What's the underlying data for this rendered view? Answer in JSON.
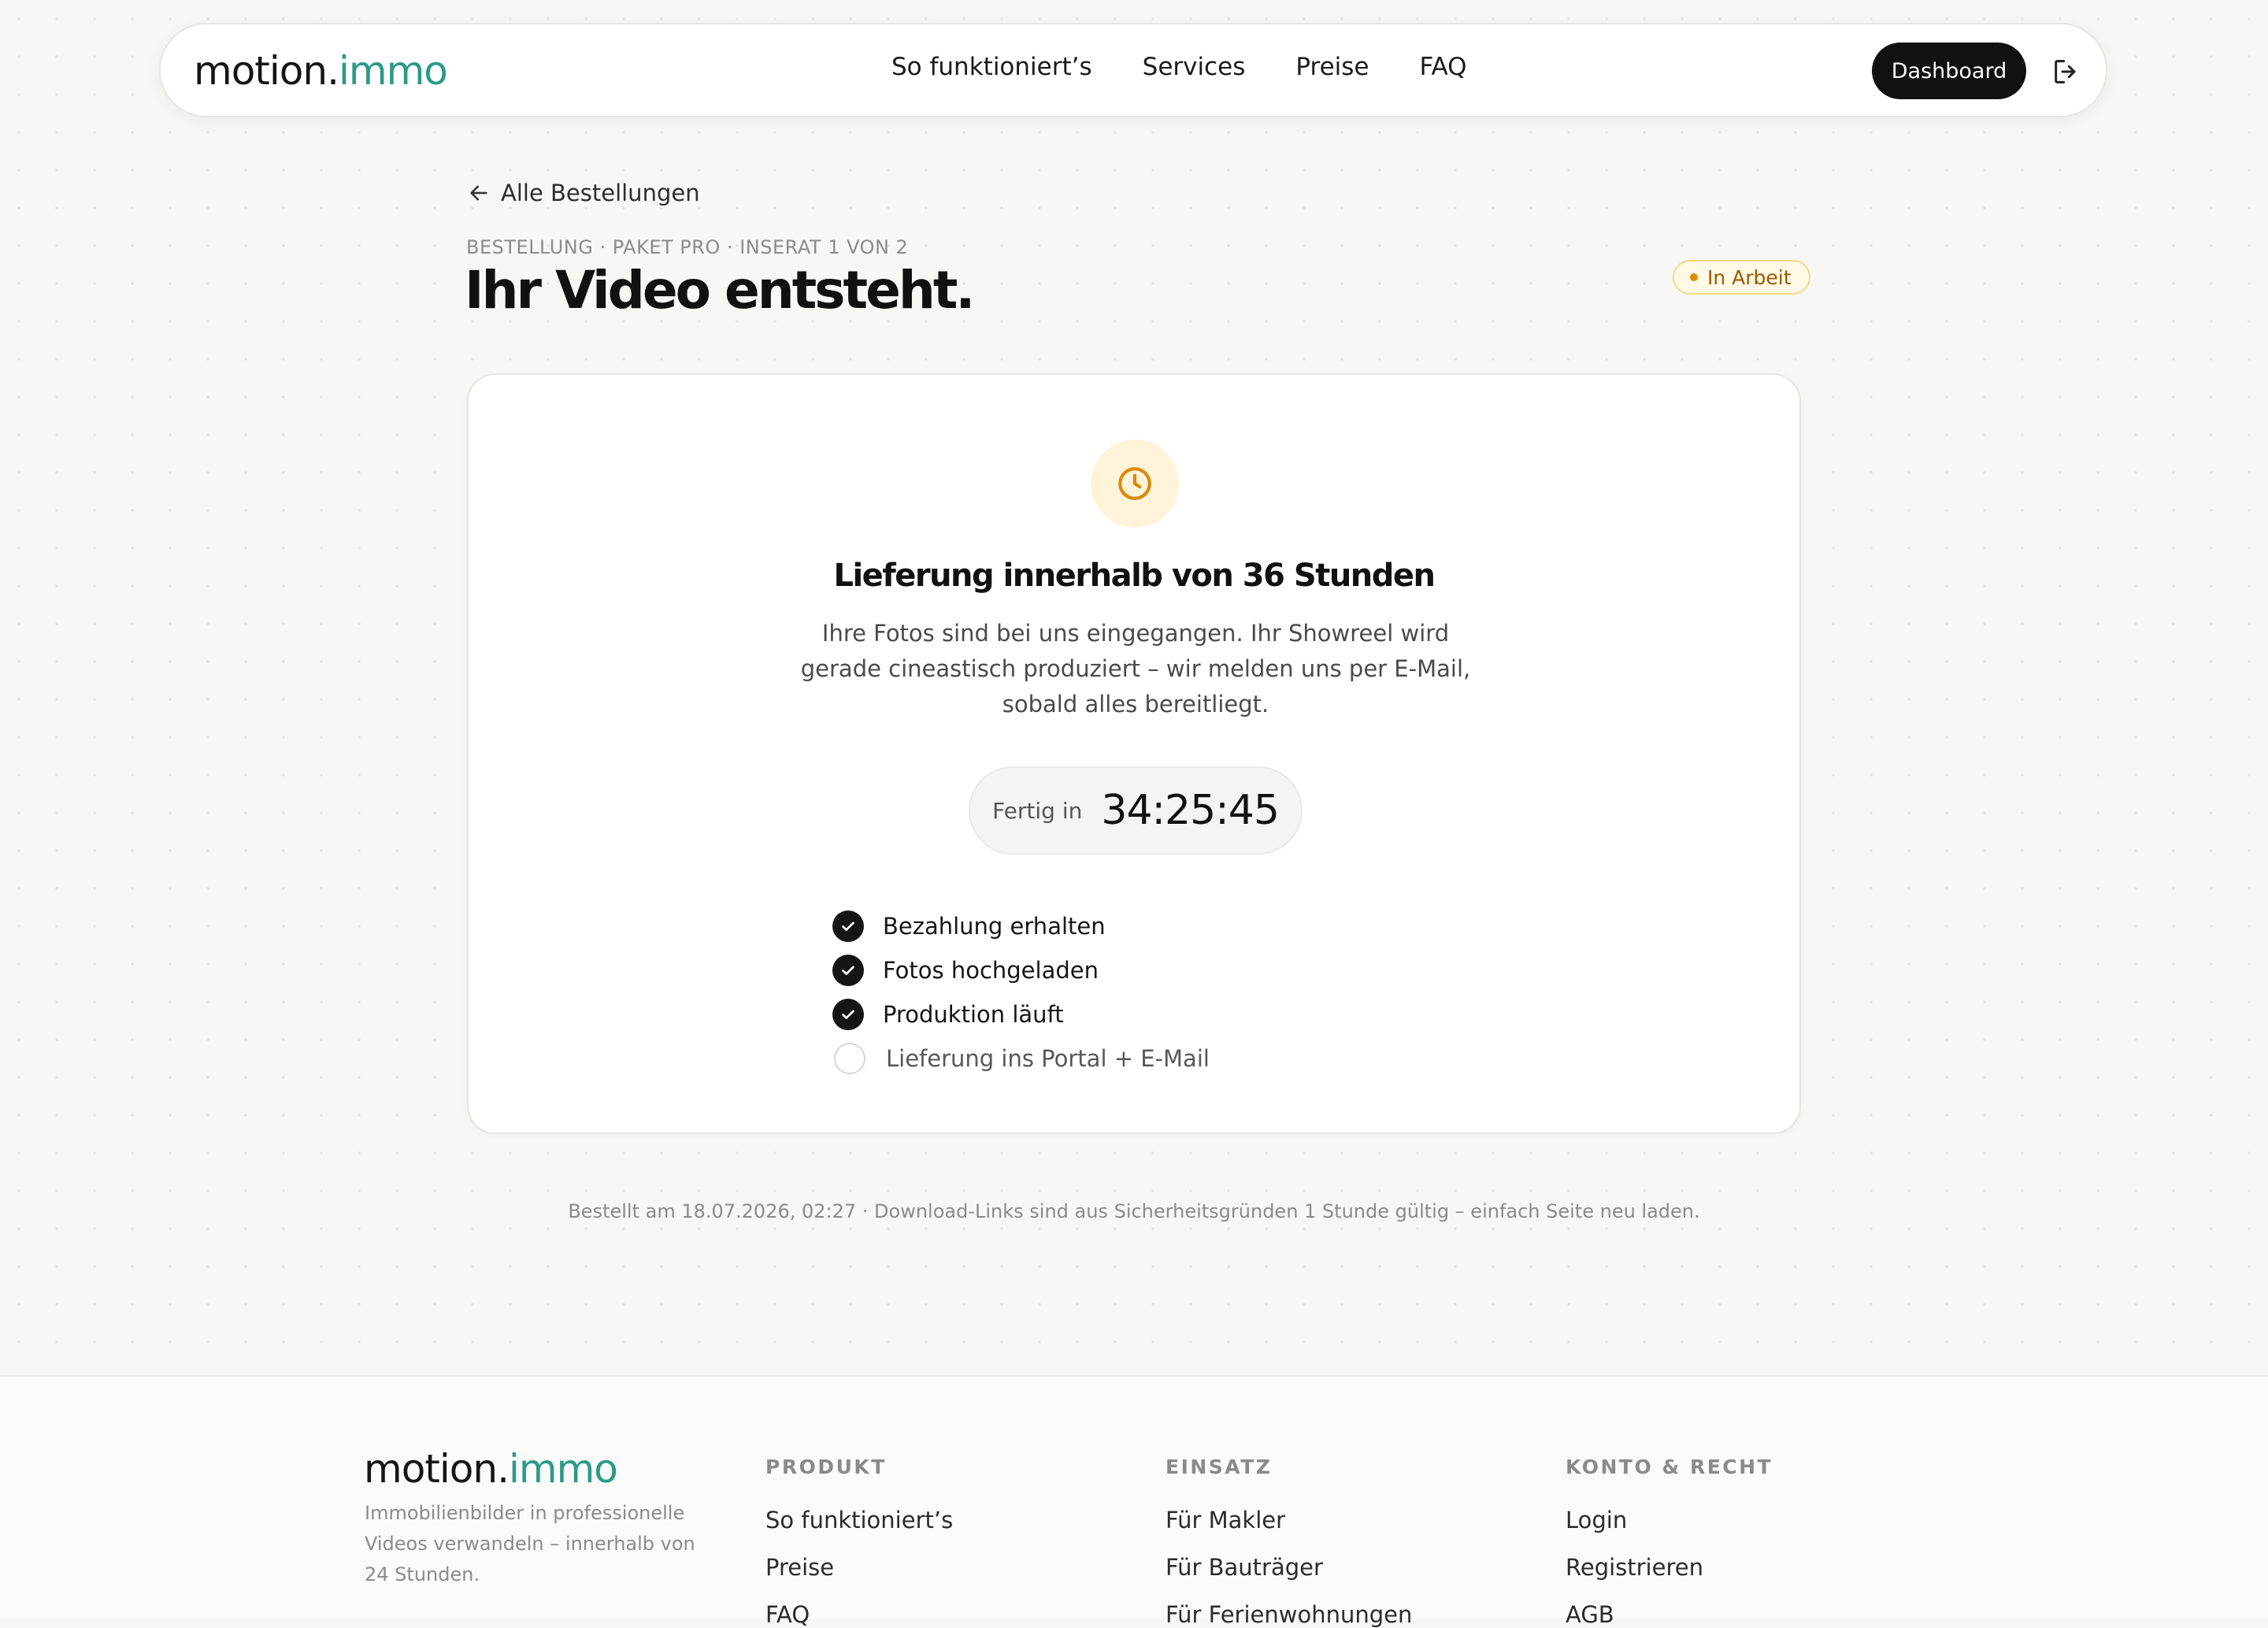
{
  "brand": {
    "part1": "motion.",
    "part2": "immo"
  },
  "nav": {
    "links": [
      "So funktioniert’s",
      "Services",
      "Preise",
      "FAQ"
    ],
    "dashboard_label": "Dashboard"
  },
  "main": {
    "back_label": "Alle Bestellungen",
    "eyebrow": "BESTELLUNG · PAKET PRO · INSERAT 1 VON 2",
    "title": "Ihr Video entsteht.",
    "status_badge": "In Arbeit"
  },
  "card": {
    "title": "Lieferung innerhalb von 36 Stunden",
    "text": "Ihre Fotos sind bei uns eingegangen. Ihr Showreel wird gerade cineastisch produziert – wir melden uns per E-Mail, sobald alles bereitliegt.",
    "timer_label": "Fertig in",
    "timer_value": "34:25:45",
    "steps": [
      {
        "label": "Bezahlung erhalten",
        "done": true
      },
      {
        "label": "Fotos hochgeladen",
        "done": true
      },
      {
        "label": "Produktion läuft",
        "done": true
      },
      {
        "label": "Lieferung ins Portal + E-Mail",
        "done": false
      }
    ]
  },
  "note": "Bestellt am 18.07.2026, 02:27 · Download-Links sind aus Sicherheitsgründen 1 Stunde gültig – einfach Seite neu laden.",
  "footer": {
    "tagline": "Immobilienbilder in professionelle Videos verwandeln – innerhalb von 24 Stunden.",
    "columns": [
      {
        "heading": "PRODUKT",
        "links": [
          "So funktioniert’s",
          "Preise",
          "FAQ"
        ]
      },
      {
        "heading": "EINSATZ",
        "links": [
          "Für Makler",
          "Für Bauträger",
          "Für Ferienwohnungen"
        ]
      },
      {
        "heading": "KONTO & RECHT",
        "links": [
          "Login",
          "Registrieren",
          "AGB"
        ]
      }
    ]
  },
  "colors": {
    "accent": "#2a9a88",
    "status_bg": "#fff9e6",
    "status_text": "#9a5a00",
    "clock": "#d98a08"
  },
  "icons": {
    "back": "arrow-left-icon",
    "logout": "logout-icon",
    "clock": "clock-icon",
    "check": "check-icon"
  }
}
